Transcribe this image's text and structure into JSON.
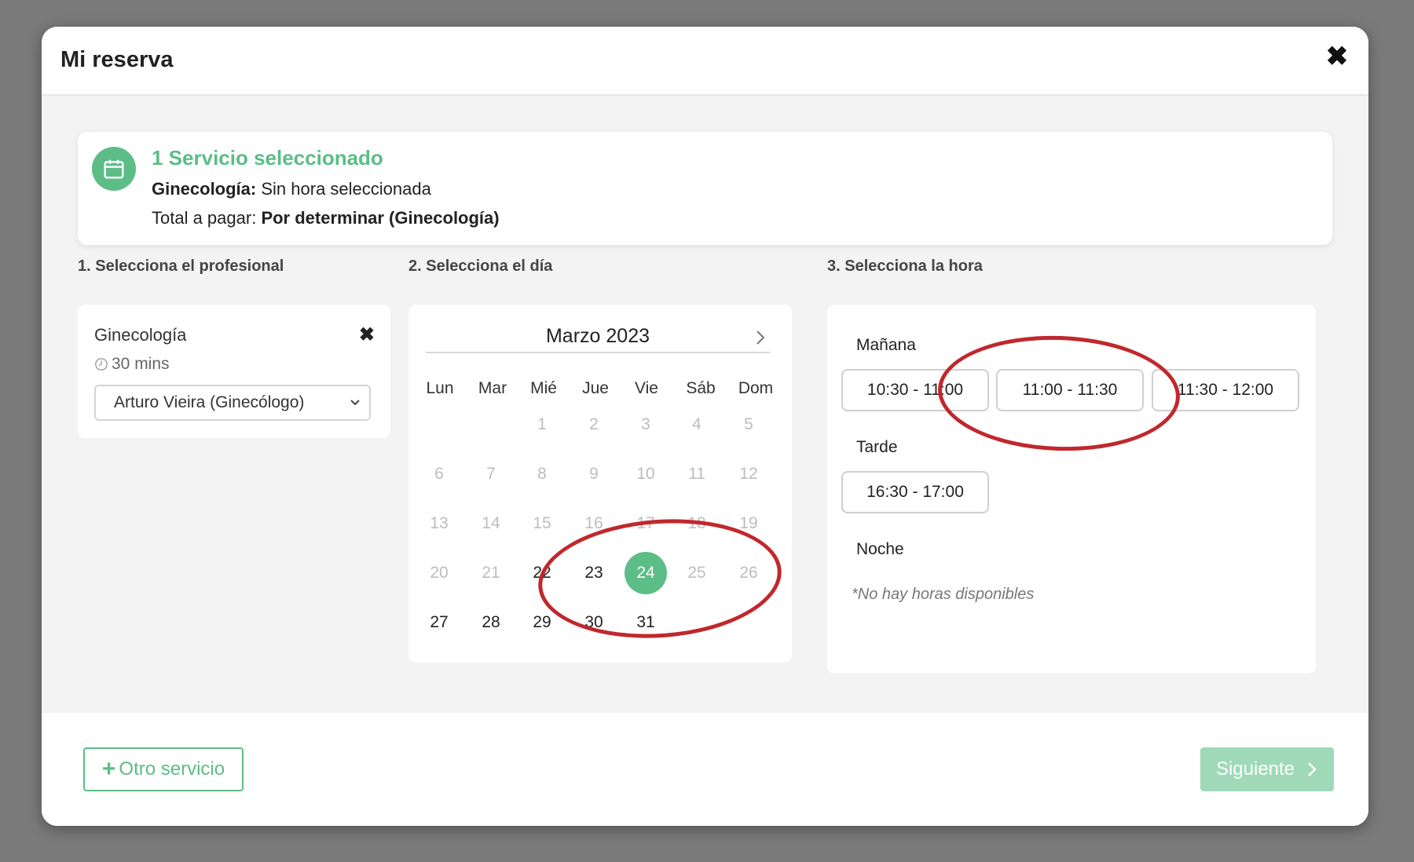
{
  "modal": {
    "title": "Mi reserva",
    "close_icon": "close-icon"
  },
  "summary": {
    "icon": "calendar-icon",
    "title": "1 Servicio seleccionado",
    "service_name": "Ginecología:",
    "service_status": "Sin hora seleccionada",
    "total_label": "Total a pagar:",
    "total_value": "Por determinar (Ginecología)"
  },
  "steps": {
    "professional": "1. Selecciona el profesional",
    "day": "2. Selecciona el día",
    "hour": "3. Selecciona la hora"
  },
  "professional": {
    "service": "Ginecología",
    "duration": "30 mins",
    "selected": "Arturo Vieira (Ginecólogo)"
  },
  "calendar": {
    "month": "Marzo 2023",
    "weekdays": [
      "Lun",
      "Mar",
      "Mié",
      "Jue",
      "Vie",
      "Sáb",
      "Dom"
    ],
    "days": {
      "d1": "1",
      "d2": "2",
      "d3": "3",
      "d4": "4",
      "d5": "5",
      "d6": "6",
      "d7": "7",
      "d8": "8",
      "d9": "9",
      "d10": "10",
      "d11": "11",
      "d12": "12",
      "d13": "13",
      "d14": "14",
      "d15": "15",
      "d16": "16",
      "d17": "17",
      "d18": "18",
      "d19": "19",
      "d20": "20",
      "d21": "21",
      "d22": "22",
      "d23": "23",
      "d24": "24",
      "d25": "25",
      "d26": "26",
      "d27": "27",
      "d28": "28",
      "d29": "29",
      "d30": "30",
      "d31": "31"
    },
    "selected_day": "24",
    "accent_color": "#5cbd86"
  },
  "times": {
    "morning_label": "Mañana",
    "morning_slots": [
      "10:30 - 11:00",
      "11:00 - 11:30",
      "11:30 - 12:00"
    ],
    "afternoon_label": "Tarde",
    "afternoon_slots": [
      "16:30 - 17:00"
    ],
    "night_label": "Noche",
    "night_empty": "*No hay horas disponibles"
  },
  "footer": {
    "other_service": "Otro servicio",
    "next": "Siguiente"
  },
  "colors": {
    "accent": "#5cbd86",
    "accent_disabled": "#9fd9b8",
    "annotation": "#c0282d"
  }
}
